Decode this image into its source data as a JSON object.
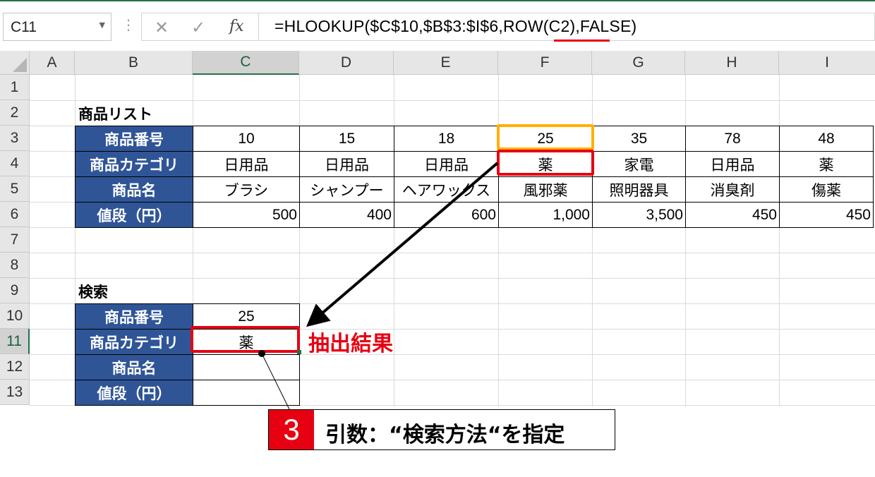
{
  "namebox": {
    "value": "C11",
    "dropdown_icon": "chevron-down"
  },
  "formula_bar": {
    "cancel_icon": "✕",
    "enter_icon": "✓",
    "fx_label": "fx",
    "formula": "=HLOOKUP($C$10,$B$3:$I$6,ROW(C2),FALSE)"
  },
  "columns": [
    "A",
    "B",
    "C",
    "D",
    "E",
    "F",
    "G",
    "H",
    "I"
  ],
  "rows": [
    "1",
    "2",
    "3",
    "4",
    "5",
    "6",
    "7",
    "8",
    "9",
    "10",
    "11",
    "12",
    "13"
  ],
  "selected_cell": {
    "column": "C",
    "row": "11"
  },
  "product_list": {
    "title": "商品リスト",
    "headers": [
      "商品番号",
      "商品カテゴリ",
      "商品名",
      "値段（円）"
    ],
    "numbers": [
      "10",
      "15",
      "18",
      "25",
      "35",
      "78",
      "48"
    ],
    "categories": [
      "日用品",
      "日用品",
      "日用品",
      "薬",
      "家電",
      "日用品",
      "薬"
    ],
    "names": [
      "ブラシ",
      "シャンプー",
      "ヘアワックス",
      "風邪薬",
      "照明器具",
      "消臭剤",
      "傷薬"
    ],
    "prices": [
      "500",
      "400",
      "600",
      "1,000",
      "3,500",
      "450",
      "450"
    ]
  },
  "search": {
    "title": "検索",
    "headers": [
      "商品番号",
      "商品カテゴリ",
      "商品名",
      "値段（円）"
    ],
    "values": [
      "25",
      "薬",
      "",
      ""
    ]
  },
  "annotations": {
    "result_label": "抽出結果",
    "step_number": "3",
    "step_text": "引数：“検索方法“を指定",
    "highlight_colors": {
      "lookup_value": "#ffb000",
      "match": "#e60012"
    }
  }
}
